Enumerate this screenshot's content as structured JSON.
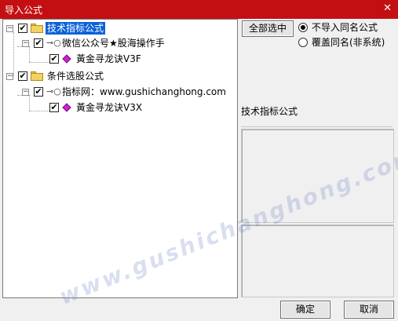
{
  "window": {
    "title": "导入公式",
    "close_glyph": "✕"
  },
  "tree": {
    "nodes": [
      {
        "label": "技术指标公式",
        "checked": true,
        "selected": true,
        "icon": "folder-icon"
      },
      {
        "label": "微信公众号★股海操作手",
        "checked": true,
        "icon": "key-icon"
      },
      {
        "label": "黃金寻龙诀V3F",
        "checked": true,
        "icon": "formula-gem-icon"
      },
      {
        "label": "条件选股公式",
        "checked": true,
        "icon": "folder-icon"
      },
      {
        "label": "指标网：www.gushichanghong.com",
        "checked": true,
        "icon": "key-icon"
      },
      {
        "label": "黃金寻龙诀V3X",
        "checked": true,
        "icon": "formula-gem-icon"
      }
    ],
    "expander_glyph": "−",
    "check_glyph": "✔"
  },
  "options": {
    "select_all_label": "全部选中",
    "radio_no_import": "不导入同名公式",
    "radio_overwrite": "覆盖同名(非系统)",
    "selected_radio": "no_import"
  },
  "detail": {
    "type_label": "技术指标公式"
  },
  "footer": {
    "ok_label": "确定",
    "cancel_label": "取消"
  },
  "watermark": "www.gushichanghong.com",
  "colors": {
    "titlebar": "#c40f12",
    "selection": "#0b62d6",
    "gem": "#d21fd8",
    "folder": "#f3d264"
  }
}
